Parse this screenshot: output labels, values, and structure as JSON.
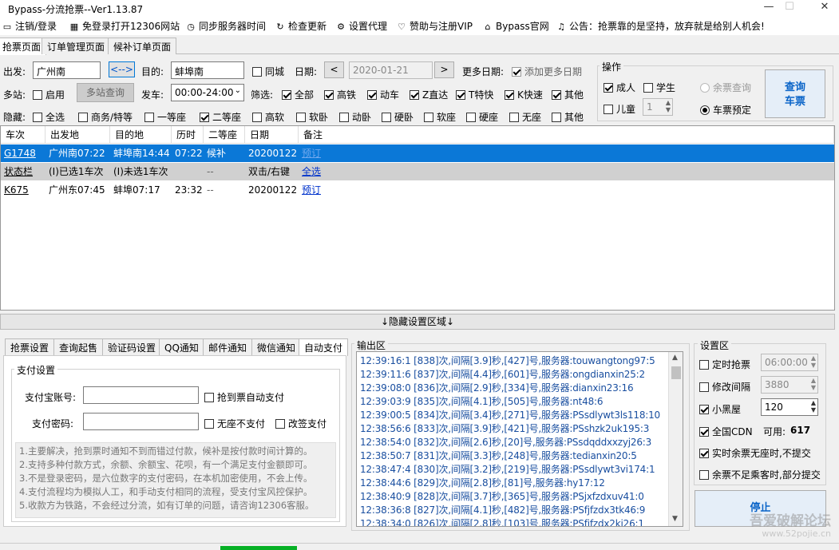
{
  "window": {
    "title": "Bypass-分流抢票--Ver1.13.87"
  },
  "menu": [
    {
      "icon": "monitor-icon",
      "label": "注销/登录"
    },
    {
      "icon": "grid-icon",
      "label": "免登录打开12306网站"
    },
    {
      "icon": "clock-icon",
      "label": "同步服务器时间"
    },
    {
      "icon": "refresh-icon",
      "label": "检查更新"
    },
    {
      "icon": "gear-icon",
      "label": "设置代理"
    },
    {
      "icon": "heart-icon",
      "label": "赞助与注册VIP"
    },
    {
      "icon": "home-icon",
      "label": "Bypass官网"
    },
    {
      "icon": "bell-icon",
      "label": "公告：抢票靠的是坚持，放弃就是给别人机会!"
    }
  ],
  "tabs": [
    "抢票页面",
    "订单管理页面",
    "候补订单页面"
  ],
  "search": {
    "from_label": "出发:",
    "from_value": "广州南",
    "swap_label": "<-->",
    "to_label": "目的:",
    "to_value": "蚌埠南",
    "same_city": "同城",
    "date_label": "日期:",
    "date_value": "2020-01-21",
    "prev": "<",
    "next": ">",
    "more_dates_label": "更多日期:",
    "add_more_dates": "添加更多日期",
    "multi_label": "多站:",
    "enable": "启用",
    "multi_query": "多站查询",
    "depart_label": "发车:",
    "depart_value": "00:00-24:00",
    "filter_label": "筛选:",
    "filters": [
      {
        "label": "全部",
        "on": true
      },
      {
        "label": "高铁",
        "on": true
      },
      {
        "label": "动车",
        "on": true
      },
      {
        "label": "Z直达",
        "on": true
      },
      {
        "label": "T特快",
        "on": true
      },
      {
        "label": "K快速",
        "on": true
      },
      {
        "label": "其他",
        "on": true
      }
    ],
    "hide_label": "隐藏:",
    "hides": [
      {
        "label": "全选",
        "on": false
      },
      {
        "label": "商务/特等",
        "on": false
      },
      {
        "label": "一等座",
        "on": false
      },
      {
        "label": "二等座",
        "on": true
      },
      {
        "label": "高软",
        "on": false
      },
      {
        "label": "软卧",
        "on": false
      },
      {
        "label": "动卧",
        "on": false
      },
      {
        "label": "硬卧",
        "on": false
      },
      {
        "label": "软座",
        "on": false
      },
      {
        "label": "硬座",
        "on": false
      },
      {
        "label": "无座",
        "on": false
      },
      {
        "label": "其他",
        "on": false
      }
    ]
  },
  "ops": {
    "title": "操作",
    "adult": "成人",
    "student": "学生",
    "child": "儿童",
    "child_count": "1",
    "remain_query": "余票查询",
    "booking": "车票预定",
    "query_btn_1": "查询",
    "query_btn_2": "车票"
  },
  "grid": {
    "headers": [
      "车次",
      "出发地",
      "目的地",
      "历时",
      "二等座",
      "日期",
      "备注"
    ],
    "rows": [
      [
        "G1748",
        "广州南07:22",
        "蚌埠南14:44",
        "07:22",
        "候补",
        "20200122",
        "预订"
      ],
      [
        "状态栏",
        "(I)已选1车次",
        "(I)未选1车次",
        "",
        "--",
        "双击/右键",
        "全选"
      ],
      [
        "K675",
        "广州东07:45",
        "蚌埠07:17",
        "23:32",
        "--",
        "20200122",
        "预订"
      ]
    ]
  },
  "divider": "↓隐藏设置区域↓",
  "bottom_tabs": [
    "抢票设置",
    "查询起售",
    "验证码设置",
    "QQ通知",
    "邮件通知",
    "微信通知",
    "自动支付"
  ],
  "payment": {
    "title": "支付设置",
    "alipay_label": "支付宝账号:",
    "auto_pay": "抢到票自动支付",
    "pwd_label": "支付密码:",
    "no_seat_no_pay": "无座不支付",
    "rebook_pay": "改签支付",
    "notes": [
      "1.主要解决，抢到票时通知不到而错过付款，候补是按付款时间计算的。",
      "2.支持多种付款方式，余额、余额宝、花呗，有一个满足支付金额即可。",
      "3.不是登录密码，是六位数字的支付密码，在本机加密使用，不会上传。",
      "4.支付流程均为模拟人工，和手动支付相同的流程，受支付宝风控保护。",
      "5.收款方为铁路，不会经过分流，如有订单的问题，请咨询12306客服。"
    ]
  },
  "output": {
    "title": "输出区",
    "lines": [
      "12:39:16:1  [838]次,间隔[3.9]秒,[427]号,服务器:touwangtong97:5",
      "12:39:11:6  [837]次,间隔[4.4]秒,[601]号,服务器:ongdianxin25:2",
      "12:39:08:0  [836]次,间隔[2.9]秒,[334]号,服务器:dianxin23:16",
      "12:39:03:9  [835]次,间隔[4.1]秒,[505]号,服务器:nt48:6",
      "12:39:00:5  [834]次,间隔[3.4]秒,[271]号,服务器:PSsdlywt3ls118:10",
      "12:38:56:6  [833]次,间隔[3.9]秒,[421]号,服务器:PSshzk2uk195:3",
      "12:38:54:0  [832]次,间隔[2.6]秒,[20]号,服务器:PSsdqddxxzyj26:3",
      "12:38:50:7  [831]次,间隔[3.3]秒,[248]号,服务器:tedianxin20:5",
      "12:38:47:4  [830]次,间隔[3.2]秒,[219]号,服务器:PSsdlywt3vi174:1",
      "12:38:44:6  [829]次,间隔[2.8]秒,[81]号,服务器:hy17:12",
      "12:38:40:9  [828]次,间隔[3.7]秒,[365]号,服务器:PSjxfzdxuv41:0",
      "12:38:36:8  [827]次,间隔[4.1]秒,[482]号,服务器:PSfjfzdx3tk46:9",
      "12:38:34:0  [826]次,间隔[2.8]秒,[103]号,服务器:PSfjfzdx2ki26:1"
    ]
  },
  "settings": {
    "title": "设置区",
    "timed": "定时抢票",
    "timed_value": "06:00:00",
    "interval": "修改间隔",
    "interval_value": "3880",
    "blackroom": "小黑屋",
    "blackroom_value": "120",
    "cdn": "全国CDN",
    "available_label": "可用:",
    "available_value": "617",
    "no_seat": "实时余票无座时,不提交",
    "partial": "余票不足乘客时,部分提交",
    "stop": "停止"
  },
  "watermark": {
    "main": "吾爱破解论坛",
    "sub": "www.52pojie.cn"
  }
}
